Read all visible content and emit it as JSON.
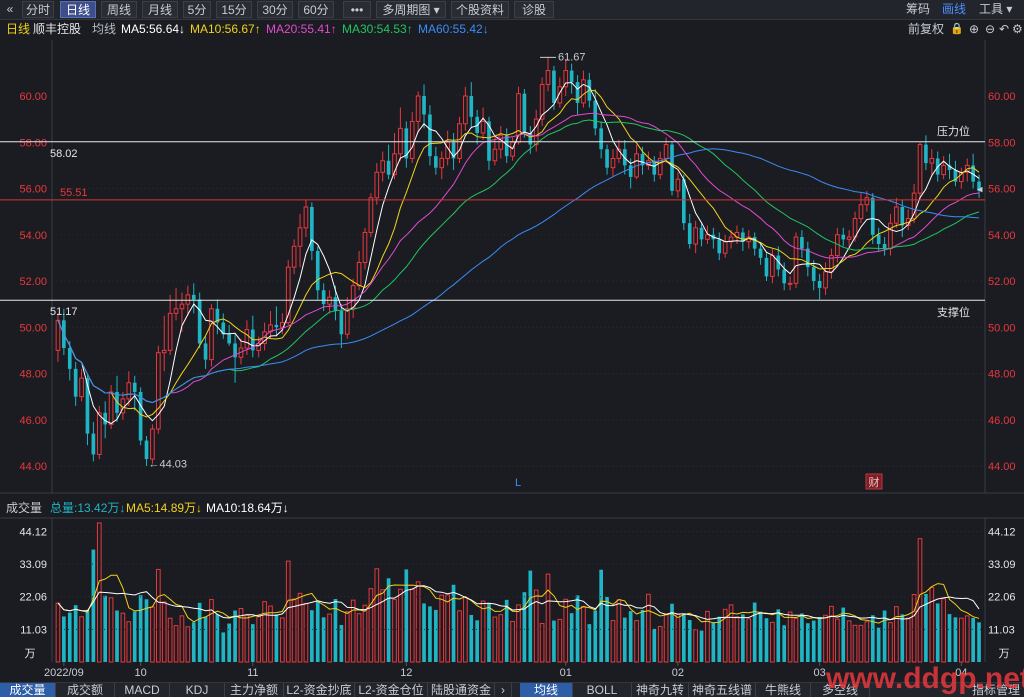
{
  "toolbar": {
    "back_icon": "double-chevron-left-icon",
    "tabs": [
      "分时",
      "日线",
      "周线",
      "月线",
      "5分",
      "15分",
      "30分",
      "60分",
      "•••",
      "多周期图 ▾",
      "个股资料",
      "诊股"
    ],
    "active_tab": "日线",
    "right_items": [
      "筹码",
      "画线",
      "工具 ▾"
    ]
  },
  "info": {
    "period": "日线",
    "stock_name": "顺丰控股",
    "ma_label": "均线",
    "ma5": "MA5:56.64↓",
    "ma10": "MA10:56.67↑",
    "ma20": "MA20:55.41↑",
    "ma30": "MA30:54.53↑",
    "ma60": "MA60:55.42↓",
    "adjust": "前复权",
    "icons": [
      "lock-icon",
      "zoom-in-icon",
      "zoom-out-icon",
      "undo-icon",
      "settings-icon"
    ]
  },
  "colors": {
    "up": "#e8383d",
    "down": "#1fb5c4",
    "ma5": "#ffffff",
    "ma10": "#f2d21a",
    "ma20": "#e14ad1",
    "ma30": "#22c55e",
    "ma60": "#3b8cf5",
    "vol_ma5": "#f2d21a",
    "vol_ma10": "#ffffff",
    "support_line": "#e8e8e8",
    "resistance_line": "#e8e8e8",
    "price_line": "#d8343a"
  },
  "annotations": {
    "high_label": "61.67",
    "low_label": "←44.03",
    "resistance_value": "58.02",
    "resistance_text": "压力位",
    "support_value": "51.17",
    "support_text": "支撑位",
    "current_line_value": "55.51",
    "marker_l": "L",
    "marker_cai": "财"
  },
  "volume": {
    "title": "成交量",
    "total": "总量:13.42万↓",
    "ma5": "MA5:14.89万↓",
    "ma10": "MA10:18.64万↓",
    "unit": "万"
  },
  "bottom_tabs": [
    "成交量",
    "成交额",
    "MACD",
    "KDJ",
    "主力净额",
    "L2-资金抄底",
    "L2-资金仓位",
    "陆股通资金",
    "›",
    "均线",
    "BOLL",
    "神奇九转",
    "神奇五线谱",
    "牛熊线",
    "多空线",
    "",
    "指标管理"
  ],
  "bottom_active": [
    "成交量",
    "均线"
  ],
  "watermark": "www.ddgp.net",
  "chart_data": {
    "type": "candlestick",
    "price_axis": {
      "ticks": [
        "60.00",
        "58.00",
        "56.00",
        "54.00",
        "52.00",
        "50.00",
        "48.00",
        "46.00",
        "44.00"
      ],
      "ylim": [
        43.5,
        62.5
      ]
    },
    "volume_axis": {
      "ticks": [
        "44.12",
        "33.09",
        "22.06",
        "11.03"
      ],
      "ylim": [
        0,
        48
      ]
    },
    "x_labels": [
      "2022/09",
      "10",
      "11",
      "12",
      "01",
      "02",
      "03",
      "04"
    ],
    "x_label_days": [
      1,
      14,
      33,
      59,
      86,
      105,
      129,
      153
    ],
    "horizontal_lines": {
      "resistance": 58.02,
      "support": 51.17,
      "current": 55.51
    },
    "high": 61.67,
    "low": 44.03,
    "candles": [
      [
        49.0,
        50.3,
        50.6,
        48.5,
        19.9
      ],
      [
        50.3,
        49.1,
        50.8,
        48.8,
        15.4
      ],
      [
        49.1,
        48.2,
        49.4,
        47.7,
        16.7
      ],
      [
        48.2,
        47.0,
        48.5,
        46.6,
        19.2
      ],
      [
        47.0,
        47.8,
        48.2,
        46.8,
        15.3
      ],
      [
        47.8,
        45.4,
        48.0,
        44.9,
        17.6
      ],
      [
        45.4,
        44.5,
        45.9,
        44.2,
        38.0
      ],
      [
        44.5,
        46.3,
        46.6,
        44.3,
        47.0
      ],
      [
        46.3,
        45.8,
        46.8,
        45.2,
        22.4
      ],
      [
        45.8,
        47.2,
        47.5,
        45.6,
        21.7
      ],
      [
        47.2,
        46.3,
        47.9,
        45.9,
        17.4
      ],
      [
        46.3,
        46.9,
        47.2,
        46.0,
        16.5
      ],
      [
        46.9,
        47.6,
        48.1,
        46.6,
        13.6
      ],
      [
        47.6,
        47.2,
        47.9,
        46.4,
        17.1
      ],
      [
        47.2,
        45.1,
        47.4,
        44.9,
        22.6
      ],
      [
        45.1,
        44.3,
        45.3,
        44.0,
        21.2
      ],
      [
        44.3,
        45.6,
        45.8,
        44.1,
        18.6
      ],
      [
        45.6,
        48.9,
        49.2,
        45.4,
        31.3
      ],
      [
        48.9,
        49.0,
        50.5,
        48.1,
        20.3
      ],
      [
        49.0,
        50.6,
        51.4,
        48.8,
        14.8
      ],
      [
        50.6,
        50.8,
        51.7,
        50.3,
        12.3
      ],
      [
        50.8,
        51.0,
        51.5,
        49.8,
        15.6
      ],
      [
        51.0,
        51.4,
        51.8,
        50.5,
        11.9
      ],
      [
        51.4,
        51.2,
        51.9,
        50.6,
        13.4
      ],
      [
        51.2,
        49.3,
        51.5,
        49.1,
        20.0
      ],
      [
        49.3,
        48.6,
        49.6,
        48.2,
        15.3
      ],
      [
        48.6,
        50.8,
        51.0,
        48.3,
        21.1
      ],
      [
        50.8,
        50.2,
        51.2,
        49.7,
        16.1
      ],
      [
        50.2,
        49.7,
        50.6,
        49.5,
        10.0
      ],
      [
        49.7,
        49.3,
        50.1,
        49.2,
        13.0
      ],
      [
        49.3,
        48.7,
        49.7,
        47.6,
        17.4
      ],
      [
        48.7,
        49.1,
        49.5,
        48.4,
        18.1
      ],
      [
        49.1,
        49.9,
        50.3,
        48.8,
        15.8
      ],
      [
        49.9,
        49.0,
        50.5,
        48.7,
        12.8
      ],
      [
        49.0,
        49.3,
        49.6,
        48.7,
        15.3
      ],
      [
        49.3,
        49.8,
        50.2,
        49.0,
        20.4
      ],
      [
        49.8,
        50.1,
        50.7,
        49.5,
        18.9
      ],
      [
        50.1,
        50.0,
        50.9,
        49.6,
        16.1
      ],
      [
        50.0,
        50.2,
        50.6,
        49.7,
        14.9
      ],
      [
        50.2,
        52.6,
        52.9,
        50.1,
        34.1
      ],
      [
        52.6,
        53.5,
        53.8,
        52.3,
        21.3
      ],
      [
        53.5,
        54.3,
        54.9,
        52.6,
        23.2
      ],
      [
        54.3,
        55.2,
        55.5,
        53.9,
        19.8
      ],
      [
        55.2,
        53.3,
        55.4,
        52.9,
        17.5
      ],
      [
        53.3,
        51.6,
        53.5,
        51.2,
        20.7
      ],
      [
        51.6,
        51.0,
        51.9,
        50.7,
        15.1
      ],
      [
        51.0,
        51.3,
        51.6,
        50.6,
        16.2
      ],
      [
        51.3,
        50.7,
        51.8,
        50.3,
        21.3
      ],
      [
        50.7,
        49.7,
        51.0,
        49.1,
        12.5
      ],
      [
        49.7,
        50.8,
        51.3,
        49.5,
        17.0
      ],
      [
        50.8,
        51.8,
        52.1,
        50.4,
        20.9
      ],
      [
        51.8,
        52.8,
        53.3,
        51.6,
        16.3
      ],
      [
        52.8,
        54.1,
        54.3,
        52.5,
        19.2
      ],
      [
        54.1,
        55.6,
        55.8,
        53.9,
        24.8
      ],
      [
        55.6,
        56.7,
        57.1,
        55.3,
        31.5
      ],
      [
        56.7,
        57.2,
        57.6,
        56.3,
        24.4
      ],
      [
        57.2,
        56.6,
        57.9,
        56.4,
        28.3
      ],
      [
        56.6,
        57.5,
        58.4,
        56.4,
        21.1
      ],
      [
        57.5,
        58.6,
        59.5,
        57.2,
        24.6
      ],
      [
        58.6,
        57.3,
        58.9,
        56.9,
        31.3
      ],
      [
        57.3,
        58.9,
        59.3,
        57.1,
        24.6
      ],
      [
        58.9,
        60.0,
        60.2,
        58.4,
        27.1
      ],
      [
        60.0,
        59.2,
        60.5,
        58.6,
        19.8
      ],
      [
        59.2,
        57.4,
        59.6,
        57.0,
        18.8
      ],
      [
        57.4,
        56.9,
        57.8,
        56.6,
        17.6
      ],
      [
        56.9,
        57.3,
        57.6,
        56.4,
        22.6
      ],
      [
        57.3,
        58.0,
        58.5,
        57.0,
        22.7
      ],
      [
        58.0,
        57.3,
        58.4,
        56.8,
        26.1
      ],
      [
        57.3,
        58.8,
        59.1,
        57.1,
        17.3
      ],
      [
        58.8,
        60.0,
        60.4,
        58.5,
        21.8
      ],
      [
        60.0,
        59.1,
        60.6,
        58.6,
        15.9
      ],
      [
        59.1,
        58.4,
        59.4,
        57.9,
        14.1
      ],
      [
        58.4,
        58.9,
        59.5,
        58.1,
        20.6
      ],
      [
        58.9,
        57.2,
        59.1,
        56.8,
        19.8
      ],
      [
        57.2,
        57.7,
        58.3,
        57.0,
        15.2
      ],
      [
        57.7,
        58.3,
        58.7,
        57.3,
        16.0
      ],
      [
        58.3,
        57.4,
        58.6,
        57.1,
        21.0
      ],
      [
        57.4,
        58.0,
        58.2,
        57.2,
        13.7
      ],
      [
        58.0,
        60.1,
        60.4,
        57.9,
        19.3
      ],
      [
        60.1,
        58.4,
        60.3,
        58.2,
        23.6
      ],
      [
        58.4,
        57.9,
        58.7,
        57.5,
        30.9
      ],
      [
        57.9,
        59.0,
        59.4,
        57.6,
        24.3
      ],
      [
        59.0,
        60.5,
        60.8,
        58.7,
        13.0
      ],
      [
        60.5,
        61.1,
        61.7,
        60.2,
        29.7
      ],
      [
        61.1,
        59.7,
        61.3,
        59.4,
        14.0
      ],
      [
        59.7,
        60.4,
        60.8,
        59.5,
        14.4
      ],
      [
        60.4,
        61.1,
        61.6,
        60.0,
        21.2
      ],
      [
        61.1,
        60.6,
        61.4,
        60.1,
        16.5
      ],
      [
        60.6,
        59.7,
        60.9,
        59.2,
        22.5
      ],
      [
        59.7,
        60.7,
        61.1,
        59.5,
        18.8
      ],
      [
        60.7,
        59.8,
        61.0,
        59.5,
        12.8
      ],
      [
        59.8,
        58.6,
        60.3,
        58.3,
        17.4
      ],
      [
        58.6,
        57.7,
        58.9,
        57.3,
        31.2
      ],
      [
        57.7,
        56.9,
        57.9,
        56.6,
        22.0
      ],
      [
        56.9,
        57.3,
        57.7,
        56.5,
        14.0
      ],
      [
        57.3,
        57.7,
        58.1,
        57.1,
        21.0
      ],
      [
        57.7,
        57.0,
        58.1,
        56.6,
        15.0
      ],
      [
        57.0,
        56.5,
        57.3,
        56.0,
        17.2
      ],
      [
        56.5,
        57.5,
        57.9,
        56.4,
        14.0
      ],
      [
        57.5,
        57.0,
        57.8,
        56.6,
        17.6
      ],
      [
        57.0,
        57.2,
        57.6,
        56.8,
        22.9
      ],
      [
        57.2,
        56.6,
        57.4,
        56.3,
        11.2
      ],
      [
        56.6,
        57.3,
        57.6,
        56.4,
        12.0
      ],
      [
        57.3,
        57.9,
        58.2,
        57.1,
        16.1
      ],
      [
        57.9,
        55.9,
        58.0,
        55.7,
        19.7
      ],
      [
        55.9,
        56.4,
        56.7,
        55.6,
        16.1
      ],
      [
        56.4,
        54.5,
        56.6,
        54.2,
        16.2
      ],
      [
        54.5,
        53.6,
        54.9,
        53.4,
        14.2
      ],
      [
        53.6,
        54.3,
        54.6,
        53.2,
        10.9
      ],
      [
        54.3,
        53.8,
        54.5,
        53.5,
        10.6
      ],
      [
        53.8,
        54.0,
        54.4,
        53.6,
        17.1
      ],
      [
        54.0,
        53.8,
        54.3,
        53.4,
        13.4
      ],
      [
        53.8,
        53.2,
        54.1,
        52.9,
        15.3
      ],
      [
        53.2,
        53.7,
        54.0,
        53.0,
        17.8
      ],
      [
        53.7,
        53.9,
        54.2,
        53.4,
        19.3
      ],
      [
        53.9,
        54.1,
        54.4,
        53.6,
        15.3
      ],
      [
        54.1,
        53.7,
        54.3,
        53.3,
        16.1
      ],
      [
        53.7,
        53.9,
        54.2,
        53.4,
        14.6
      ],
      [
        53.9,
        53.4,
        54.1,
        53.1,
        20.1
      ],
      [
        53.4,
        53.0,
        53.6,
        52.7,
        17.0
      ],
      [
        53.0,
        52.2,
        53.2,
        52.0,
        14.8
      ],
      [
        52.2,
        53.1,
        53.4,
        51.9,
        13.4
      ],
      [
        53.1,
        52.5,
        53.5,
        52.2,
        17.8
      ],
      [
        52.5,
        51.9,
        52.8,
        51.6,
        12.4
      ],
      [
        51.9,
        51.9,
        52.2,
        51.6,
        16.9
      ],
      [
        51.9,
        53.9,
        54.1,
        51.7,
        14.7
      ],
      [
        53.9,
        53.4,
        54.2,
        53.0,
        16.4
      ],
      [
        53.4,
        52.6,
        53.7,
        52.2,
        13.1
      ],
      [
        52.6,
        52.0,
        52.9,
        51.6,
        14.0
      ],
      [
        52.0,
        51.7,
        52.3,
        51.2,
        15.2
      ],
      [
        51.7,
        52.4,
        52.8,
        51.4,
        15.8
      ],
      [
        52.4,
        53.1,
        53.4,
        52.1,
        18.8
      ],
      [
        53.1,
        54.0,
        54.3,
        52.8,
        14.5
      ],
      [
        54.0,
        53.8,
        54.3,
        53.5,
        18.4
      ],
      [
        53.8,
        53.9,
        54.2,
        53.5,
        13.9
      ],
      [
        53.9,
        54.7,
        55.0,
        53.7,
        12.4
      ],
      [
        54.7,
        55.3,
        55.8,
        54.5,
        12.4
      ],
      [
        55.3,
        55.6,
        55.9,
        55.0,
        13.6
      ],
      [
        55.6,
        54.0,
        55.8,
        53.6,
        15.8
      ],
      [
        54.0,
        53.6,
        54.3,
        53.3,
        11.6
      ],
      [
        53.6,
        53.4,
        53.9,
        53.1,
        17.4
      ],
      [
        53.4,
        54.5,
        54.9,
        53.1,
        13.3
      ],
      [
        54.5,
        55.2,
        55.6,
        54.3,
        18.7
      ],
      [
        55.2,
        54.4,
        55.5,
        53.9,
        16.1
      ],
      [
        54.4,
        54.7,
        55.1,
        54.2,
        14.8
      ],
      [
        54.7,
        55.8,
        56.2,
        54.5,
        22.8
      ],
      [
        55.8,
        57.9,
        58.0,
        55.5,
        41.7
      ],
      [
        57.9,
        57.1,
        58.3,
        56.8,
        23.0
      ],
      [
        57.1,
        57.3,
        57.7,
        56.6,
        25.2
      ],
      [
        57.3,
        56.6,
        57.6,
        56.3,
        19.8
      ],
      [
        56.6,
        57.0,
        57.4,
        56.4,
        21.4
      ],
      [
        57.0,
        56.8,
        57.5,
        56.4,
        16.2
      ],
      [
        56.8,
        56.3,
        57.2,
        56.1,
        15.1
      ],
      [
        56.3,
        56.7,
        56.9,
        56.0,
        14.8
      ],
      [
        56.7,
        57.0,
        57.3,
        56.3,
        15.6
      ],
      [
        57.0,
        56.3,
        57.5,
        56.0,
        14.9
      ],
      [
        56.3,
        55.9,
        56.6,
        55.6,
        13.4
      ]
    ]
  }
}
